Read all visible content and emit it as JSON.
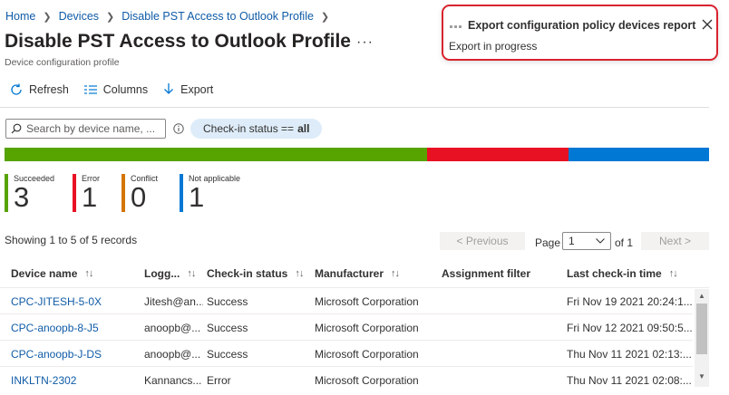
{
  "breadcrumb": [
    "Home",
    "Devices",
    "Disable PST Access to Outlook Profile"
  ],
  "title": "Disable PST Access to Outlook Profile",
  "more_label": "···",
  "subtitle": "Device configuration profile",
  "toolbar": {
    "refresh": "Refresh",
    "columns": "Columns",
    "export": "Export"
  },
  "search": {
    "placeholder": "Search by device name, ..."
  },
  "filter_pill": {
    "label": "Check-in status ==",
    "value": "all"
  },
  "status_bar": [
    {
      "name": "succeeded",
      "fraction": 0.6,
      "color": "#57a300"
    },
    {
      "name": "error",
      "fraction": 0.2,
      "color": "#e81123"
    },
    {
      "name": "not-applicable",
      "fraction": 0.2,
      "color": "#0078d4"
    }
  ],
  "tiles": [
    {
      "label": "Succeeded",
      "count": "3",
      "color": "#57a300"
    },
    {
      "label": "Error",
      "count": "1",
      "color": "#e81123"
    },
    {
      "label": "Conflict",
      "count": "0",
      "color": "#d47500"
    },
    {
      "label": "Not applicable",
      "count": "1",
      "color": "#0078d4"
    }
  ],
  "records_text": "Showing 1 to 5 of 5 records",
  "pagination": {
    "previous": "< Previous",
    "page_label": "Page",
    "page_value": "1",
    "of": "of 1",
    "next": "Next >"
  },
  "columns": [
    "Device name",
    "Logg...",
    "Check-in status",
    "Manufacturer",
    "Assignment filter",
    "Last check-in time"
  ],
  "rows": [
    [
      "CPC-JITESH-5-0X",
      "Jitesh@an...",
      "Success",
      "Microsoft Corporation",
      "",
      "Fri Nov 19 2021 20:24:1..."
    ],
    [
      "CPC-anoopb-8-J5",
      "anoopb@...",
      "Success",
      "Microsoft Corporation",
      "",
      "Fri Nov 12 2021 09:50:5..."
    ],
    [
      "CPC-anoopb-J-DS",
      "anoopb@...",
      "Success",
      "Microsoft Corporation",
      "",
      "Thu Nov 11 2021 02:13:..."
    ],
    [
      "INKLTN-2302",
      "Kannancs...",
      "Error",
      "Microsoft Corporation",
      "",
      "Thu Nov 11 2021 02:08:..."
    ]
  ],
  "notification": {
    "title": "Export configuration policy devices report",
    "message": "Export in progress"
  },
  "colors": {
    "link": "#0f5ba7",
    "accent": "#0078d4",
    "notification_border": "#d9232e"
  }
}
